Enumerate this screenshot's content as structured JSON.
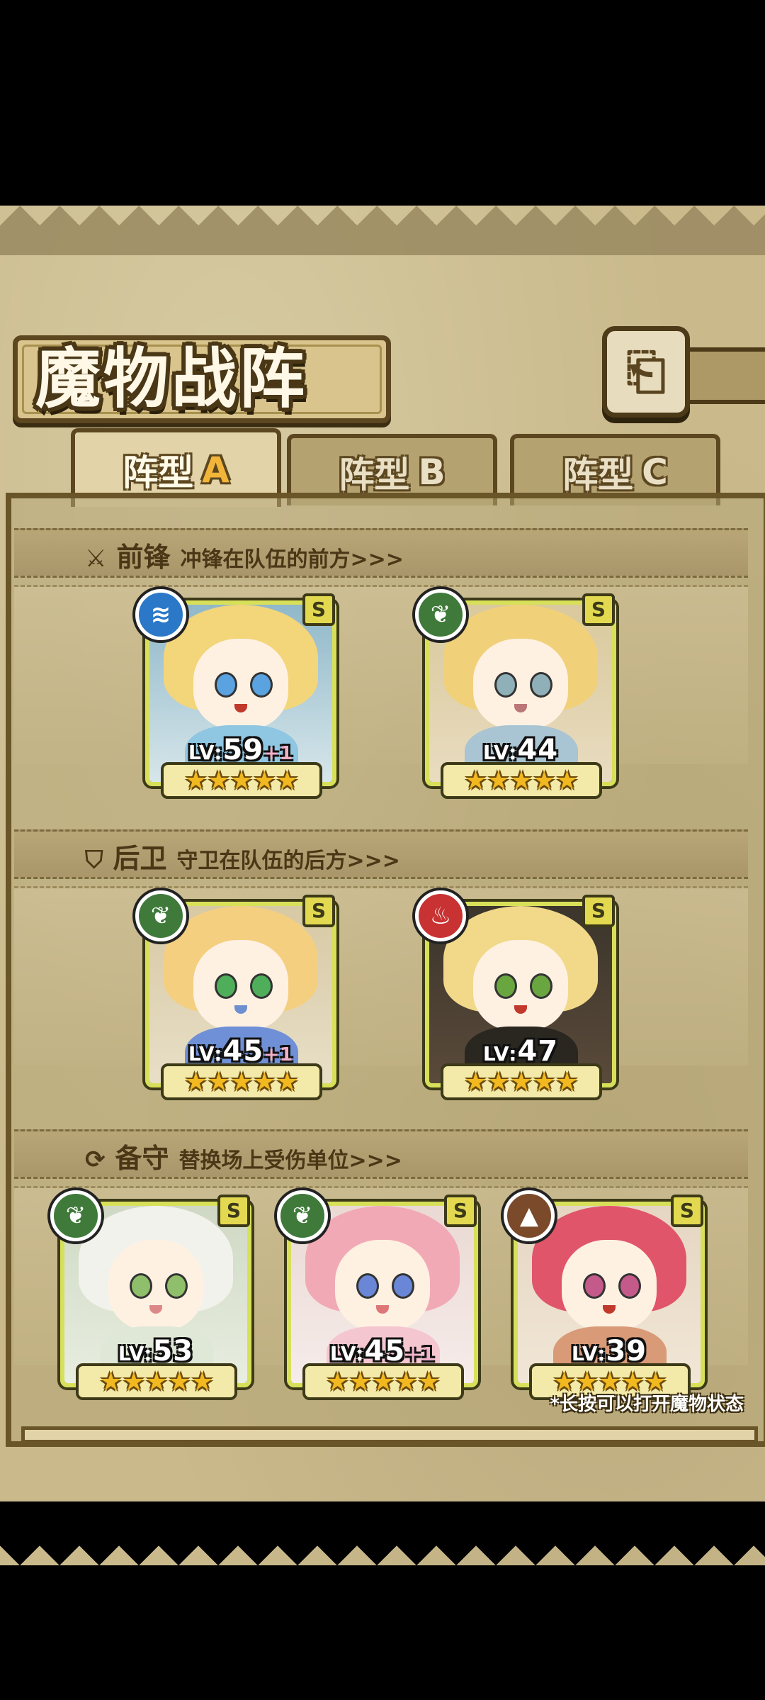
{
  "title": "魔物战阵",
  "back_icon": "back-arrow-icon",
  "tabs": [
    {
      "label": "阵型",
      "letter": "A",
      "active": true
    },
    {
      "label": "阵型",
      "letter": "B",
      "active": false
    },
    {
      "label": "阵型",
      "letter": "C",
      "active": false
    }
  ],
  "sections": {
    "front": {
      "icon": "sword-icon",
      "title": "前锋",
      "desc": "冲锋在队伍的前方>>>"
    },
    "rear": {
      "icon": "shield-icon",
      "title": "后卫",
      "desc": "守卫在队伍的后方>>>"
    },
    "reserve": {
      "icon": "swap-icon",
      "title": "备守",
      "desc": "替换场上受伤单位>>>"
    }
  },
  "cards": {
    "f1": {
      "rank": "S",
      "element": "water",
      "lv_prefix": "LV:",
      "lv": "59",
      "plus": "+1",
      "stars": "★★★★★"
    },
    "f2": {
      "rank": "S",
      "element": "leaf",
      "lv_prefix": "LV:",
      "lv": "44",
      "plus": "",
      "stars": "★★★★★"
    },
    "r1": {
      "rank": "S",
      "element": "leaf",
      "lv_prefix": "LV:",
      "lv": "45",
      "plus": "+1",
      "stars": "★★★★★"
    },
    "r2": {
      "rank": "S",
      "element": "fire",
      "lv_prefix": "LV:",
      "lv": "47",
      "plus": "",
      "stars": "★★★★★"
    },
    "b1": {
      "rank": "S",
      "element": "leaf",
      "lv_prefix": "LV:",
      "lv": "53",
      "plus": "",
      "stars": "★★★★★"
    },
    "b2": {
      "rank": "S",
      "element": "leaf",
      "lv_prefix": "LV:",
      "lv": "45",
      "plus": "+1",
      "stars": "★★★★★"
    },
    "b3": {
      "rank": "S",
      "element": "earth",
      "lv_prefix": "LV:",
      "lv": "39",
      "plus": "",
      "stars": "★★★★★"
    }
  },
  "hint": "*长按可以打开魔物状态",
  "colors": {
    "frame": "#d8e05a",
    "panel": "#c9b98b",
    "border": "#5c4720",
    "star": "#f1b820"
  }
}
